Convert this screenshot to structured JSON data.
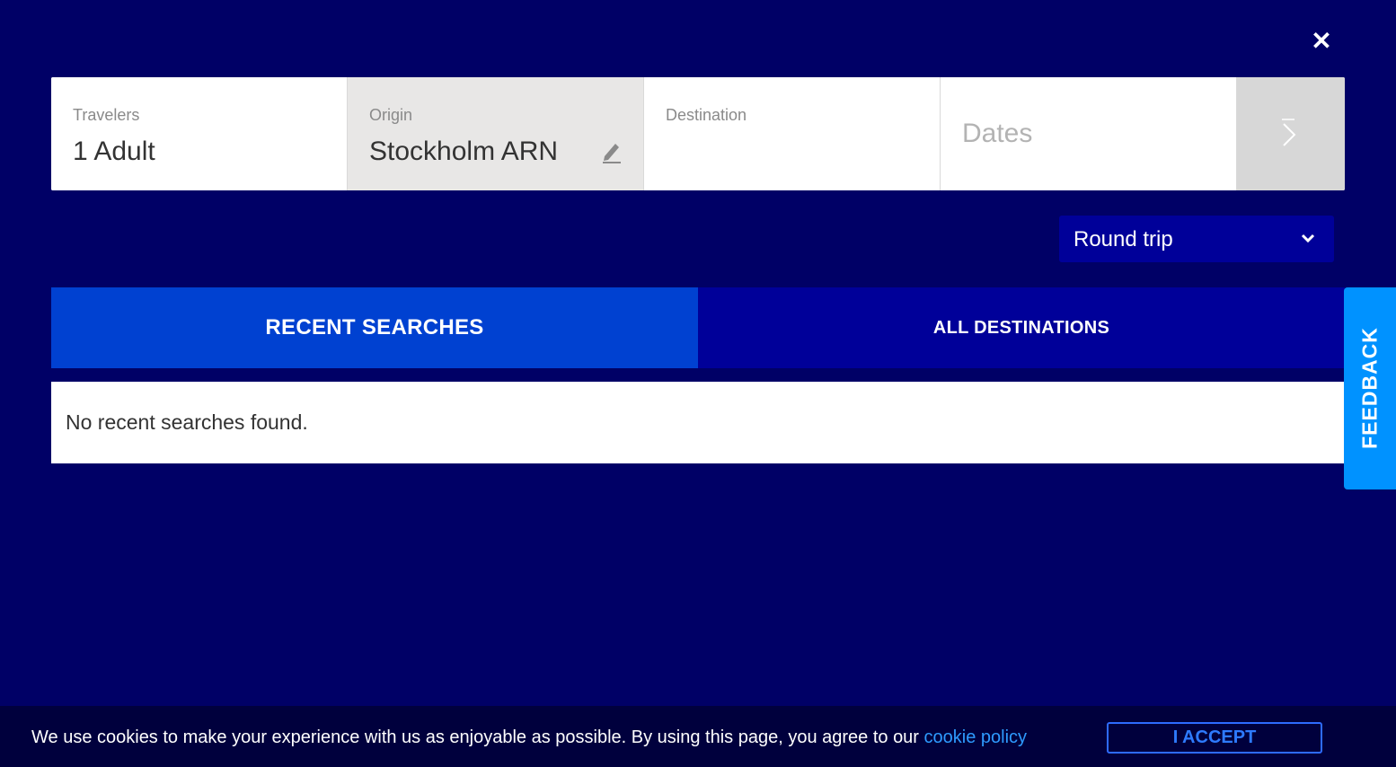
{
  "close": {
    "icon": "close-icon"
  },
  "search": {
    "travelers": {
      "label": "Travelers",
      "value": "1 Adult"
    },
    "origin": {
      "label": "Origin",
      "value": "Stockholm ARN",
      "icon": "pencil-icon"
    },
    "destination": {
      "label": "Destination",
      "value": ""
    },
    "dates": {
      "placeholder": "Dates"
    },
    "next": {
      "icon": "chevron-right-icon"
    }
  },
  "trip_type": {
    "selected": "Round trip",
    "icon": "chevron-down-icon"
  },
  "tabs": [
    {
      "label": "RECENT SEARCHES",
      "active": true
    },
    {
      "label": "ALL DESTINATIONS",
      "active": false
    }
  ],
  "results": {
    "empty_message": "No recent searches found."
  },
  "feedback": {
    "label": "FEEDBACK"
  },
  "cookie": {
    "text": "We use cookies to make your experience with us as enjoyable as possible. By using this page, you agree to our ",
    "link": "cookie policy",
    "accept": "I ACCEPT"
  },
  "colors": {
    "background": "#000066",
    "tab_active": "#0041d1",
    "tab_inactive": "#000099",
    "feedback": "#0092ff",
    "link": "#2e9bff"
  }
}
